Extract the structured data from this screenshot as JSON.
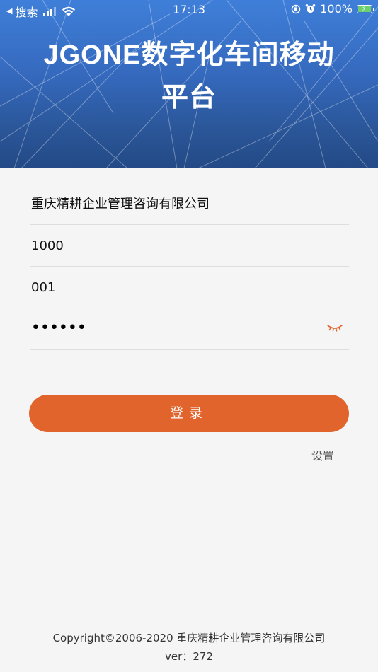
{
  "status_bar": {
    "back_label": "搜索",
    "time": "17:13",
    "battery_percent": "100%",
    "battery_level": 1.0
  },
  "header": {
    "title": "JGONE数字化车间移动平台"
  },
  "form": {
    "company": "重庆精耕企业管理咨询有限公司",
    "account_set": "1000",
    "username": "001",
    "password_mask": "••••••"
  },
  "login_button": "登录",
  "settings_link": "设置",
  "footer": {
    "copyright": "Copyright©2006-2020 重庆精耕企业管理咨询有限公司",
    "version": "ver：272"
  },
  "icons": {
    "back": "back-arrow-icon",
    "signal": "cellular-signal-icon",
    "wifi": "wifi-icon",
    "orientation_lock": "orientation-lock-icon",
    "alarm": "alarm-icon",
    "battery": "battery-charging-icon",
    "eye": "eye-closed-icon"
  },
  "colors": {
    "header_top": "#3f7fd9",
    "header_bottom": "#234a86",
    "accent": "#e0642c",
    "background": "#f5f5f5",
    "battery_fill": "#6cd16c"
  }
}
